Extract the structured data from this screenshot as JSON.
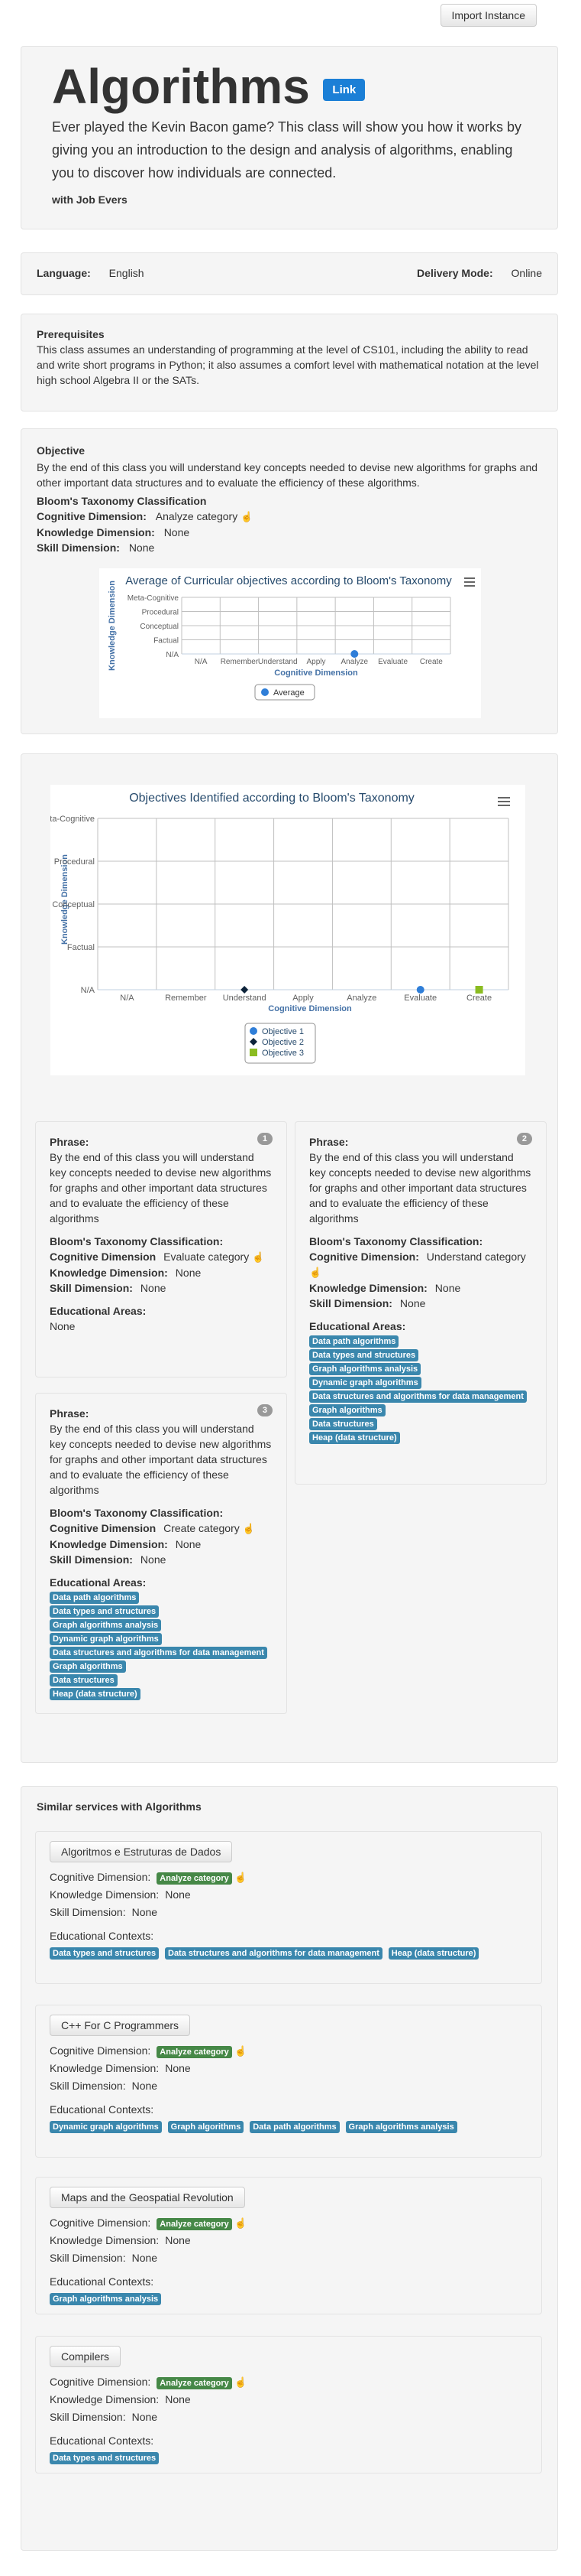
{
  "header": {
    "import_label": "Import Instance"
  },
  "hero": {
    "title": "Algorithms",
    "link_label": "Link",
    "description": "Ever played the Kevin Bacon game? This class will show you how it works by giving you an introduction to the design and analysis of algorithms, enabling you to discover how individuals are connected.",
    "author": "with Job Evers"
  },
  "info": {
    "language_label": "Language:",
    "language_value": "English",
    "delivery_label": "Delivery Mode:",
    "delivery_value": "Online"
  },
  "prereq": {
    "title": "Prerequisites",
    "text": "This class assumes an understanding of programming at the level of CS101, including the ability to read and write short programs in Python; it also assumes a comfort level with mathematical notation at the level high school Algebra II or the SATs."
  },
  "objective": {
    "title": "Objective",
    "text": "By the end of this class you will understand key concepts needed to devise new algorithms for graphs and other important data structures and to evaluate the efficiency of these algorithms.",
    "bloom_title": "Bloom's Taxonomy Classification",
    "cog_label": "Cognitive Dimension:",
    "cog_value": "Analyze category",
    "know_label": "Knowledge Dimension:",
    "know_value": "None",
    "skill_label": "Skill Dimension:",
    "skill_value": "None"
  },
  "charts": {
    "menu_icon": "hamburger-menu-icon",
    "avg": {
      "title": "Average of Curricular objectives according to Bloom's Taxonomy",
      "xlabel": "Cognitive Dimension",
      "ylabel": "Knowledge Dimension",
      "legend": "Average"
    },
    "obj": {
      "title": "Objectives Identified according to Bloom's Taxonomy",
      "xlabel": "Cognitive Dimension",
      "ylabel": "Knowledge Dimension"
    }
  },
  "chart_data": [
    {
      "type": "scatter",
      "title": "Average of Curricular objectives according to Bloom's Taxonomy",
      "xlabel": "Cognitive Dimension",
      "ylabel": "Knowledge Dimension",
      "x_categories": [
        "N/A",
        "Remember",
        "Understand",
        "Apply",
        "Analyze",
        "Evaluate",
        "Create"
      ],
      "y_categories": [
        "N/A",
        "Factual",
        "Conceptual",
        "Procedural",
        "Meta-Cognitive"
      ],
      "grid": true,
      "legend_position": "bottom",
      "series": [
        {
          "name": "Average",
          "color": "#2f7ed8",
          "marker": "circle",
          "points": [
            {
              "x": "Analyze",
              "y": "N/A"
            }
          ]
        }
      ]
    },
    {
      "type": "scatter",
      "title": "Objectives Identified according to Bloom's Taxonomy",
      "xlabel": "Cognitive Dimension",
      "ylabel": "Knowledge Dimension",
      "x_categories": [
        "N/A",
        "Remember",
        "Understand",
        "Apply",
        "Analyze",
        "Evaluate",
        "Create"
      ],
      "y_categories": [
        "N/A",
        "Factual",
        "Conceptual",
        "Procedural",
        "Meta-Cognitive"
      ],
      "grid": true,
      "legend_position": "bottom",
      "series": [
        {
          "name": "Objective 1",
          "color": "#2f7ed8",
          "marker": "circle",
          "points": [
            {
              "x": "Evaluate",
              "y": "N/A"
            }
          ]
        },
        {
          "name": "Objective 2",
          "color": "#0d233a",
          "marker": "diamond",
          "points": [
            {
              "x": "Understand",
              "y": "N/A"
            }
          ]
        },
        {
          "name": "Objective 3",
          "color": "#8bbc21",
          "marker": "square",
          "points": [
            {
              "x": "Create",
              "y": "N/A"
            }
          ]
        }
      ]
    }
  ],
  "phrases": [
    {
      "num": "1",
      "phrase_label": "Phrase:",
      "text": "By the end of this class you will understand key concepts needed to devise new algorithms for graphs and other important data structures and to evaluate the efficiency of these algorithms",
      "bloom_label": "Bloom's Taxonomy Classification:",
      "cog_label": "Cognitive Dimension",
      "cog_value": "Evaluate category",
      "know_label": "Knowledge Dimension:",
      "know_value": "None",
      "skill_label": "Skill Dimension:",
      "skill_value": "None",
      "areas_label": "Educational Areas:",
      "areas_none": "None",
      "areas": []
    },
    {
      "num": "2",
      "phrase_label": "Phrase:",
      "text": "By the end of this class you will understand key concepts needed to devise new algorithms for graphs and other important data structures and to evaluate the efficiency of these algorithms",
      "bloom_label": "Bloom's Taxonomy Classification:",
      "cog_label": "Cognitive Dimension:",
      "cog_value": "Understand category",
      "know_label": "Knowledge Dimension:",
      "know_value": "None",
      "skill_label": "Skill Dimension:",
      "skill_value": "None",
      "areas_label": "Educational Areas:",
      "areas": [
        "Data path algorithms",
        "Data types and structures",
        "Graph algorithms analysis",
        "Dynamic graph algorithms",
        "Data structures and algorithms for data management",
        "Graph algorithms",
        "Data structures",
        "Heap (data structure)"
      ]
    },
    {
      "num": "3",
      "phrase_label": "Phrase:",
      "text": "By the end of this class you will understand key concepts needed to devise new algorithms for graphs and other important data structures and to evaluate the efficiency of these algorithms",
      "bloom_label": "Bloom's Taxonomy Classification:",
      "cog_label": "Cognitive Dimension",
      "cog_value": "Create category",
      "know_label": "Knowledge Dimension:",
      "know_value": "None",
      "skill_label": "Skill Dimension:",
      "skill_value": "None",
      "areas_label": "Educational Areas:",
      "areas": [
        "Data path algorithms",
        "Data types and structures",
        "Graph algorithms analysis",
        "Dynamic graph algorithms",
        "Data structures and algorithms for data management",
        "Graph algorithms",
        "Data structures",
        "Heap (data structure)"
      ]
    }
  ],
  "similar": {
    "title": "Similar services with Algorithms",
    "cog_label": "Cognitive Dimension:",
    "know_label": "Knowledge Dimension:",
    "skill_label": "Skill Dimension:",
    "contexts_label": "Educational Contexts:",
    "services": [
      {
        "name": "Algoritmos e Estruturas de Dados",
        "cog": "Analyze category",
        "know": "None",
        "skill": "None",
        "contexts": [
          "Data types and structures",
          "Data structures and algorithms for data management",
          "Heap (data structure)"
        ]
      },
      {
        "name": "C++ For C Programmers",
        "cog": "Analyze category",
        "know": "None",
        "skill": "None",
        "contexts": [
          "Dynamic graph algorithms",
          "Graph algorithms",
          "Data path algorithms",
          "Graph algorithms analysis"
        ]
      },
      {
        "name": "Maps and the Geospatial Revolution",
        "cog": "Analyze category",
        "know": "None",
        "skill": "None",
        "contexts": [
          "Graph algorithms analysis"
        ]
      },
      {
        "name": "Compilers",
        "cog": "Analyze category",
        "know": "None",
        "skill": "None",
        "contexts": [
          "Data types and structures"
        ]
      }
    ]
  },
  "colors": {
    "tag_blue": "#3a87ad",
    "tag_green": "#468847",
    "link_blue": "#1b7fd6",
    "axis_title": "#4572a7"
  }
}
